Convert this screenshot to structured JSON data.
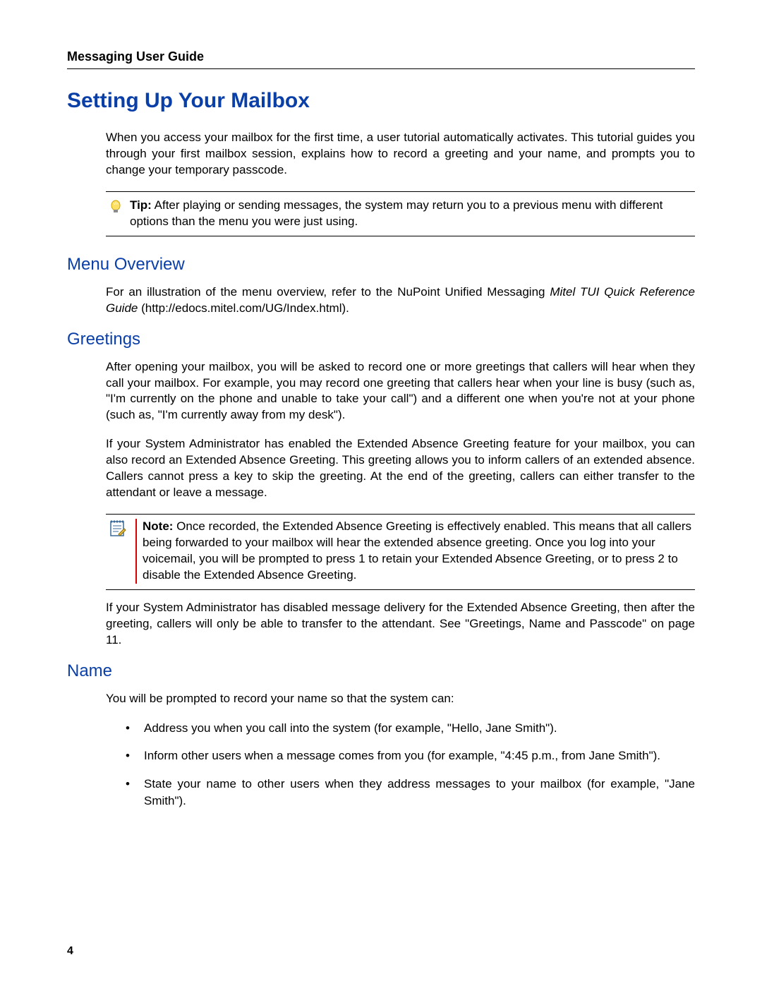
{
  "header": {
    "running_head": "Messaging User Guide"
  },
  "title": "Setting Up Your Mailbox",
  "intro": "When you access your mailbox for the first time, a user tutorial automatically activates. This tutorial guides you through your first mailbox session, explains how to record a greeting and your name, and prompts you to change your temporary passcode.",
  "tip": {
    "label": "Tip:",
    "text": " After playing or sending messages, the system may return you to a previous menu with different options than the menu you were just using."
  },
  "sections": {
    "menu_overview": {
      "heading": "Menu Overview",
      "para_prefix": "For an illustration of the menu overview, refer to the NuPoint Unified Messaging ",
      "italic": "Mitel TUI Quick Reference Guide",
      "para_suffix": " (http://edocs.mitel.com/UG/Index.html)."
    },
    "greetings": {
      "heading": "Greetings",
      "p1": "After opening your mailbox, you will be asked to record one or more greetings that callers will hear when they call your mailbox. For example, you may record one greeting that callers hear when your line is busy (such as, \"I'm currently on the phone and unable to take your call\") and a different one when you're not at your phone (such as, \"I'm currently away from my desk\").",
      "p2": "If your System Administrator has enabled the Extended Absence Greeting feature for your mailbox, you can also record an Extended Absence Greeting. This greeting allows you to inform callers of an extended absence. Callers cannot press a key to skip the greeting. At the end of the greeting, callers can either transfer to the attendant or leave a message.",
      "note_label": "Note:",
      "note_text": " Once recorded, the Extended Absence Greeting is effectively enabled. This means that all callers being forwarded to your mailbox will hear the extended absence greeting. Once you log into your voicemail, you will be prompted to press 1 to retain your Extended Absence Greeting, or to press 2 to disable the Extended Absence Greeting.",
      "p3": "If your System Administrator has disabled message delivery for the Extended Absence Greeting, then after the greeting, callers will only be able to transfer to the attendant. See \"Greetings, Name and Passcode\" on page 11."
    },
    "name": {
      "heading": "Name",
      "intro": "You will be prompted to record your name so that the system can:",
      "bullets": [
        "Address you when you call into the system (for example, \"Hello, Jane Smith\").",
        "Inform other users when a message comes from you (for example, \"4:45 p.m., from Jane Smith\").",
        "State your name to other users when they address messages to your mailbox (for example, \"Jane Smith\")."
      ]
    }
  },
  "page_number": "4"
}
